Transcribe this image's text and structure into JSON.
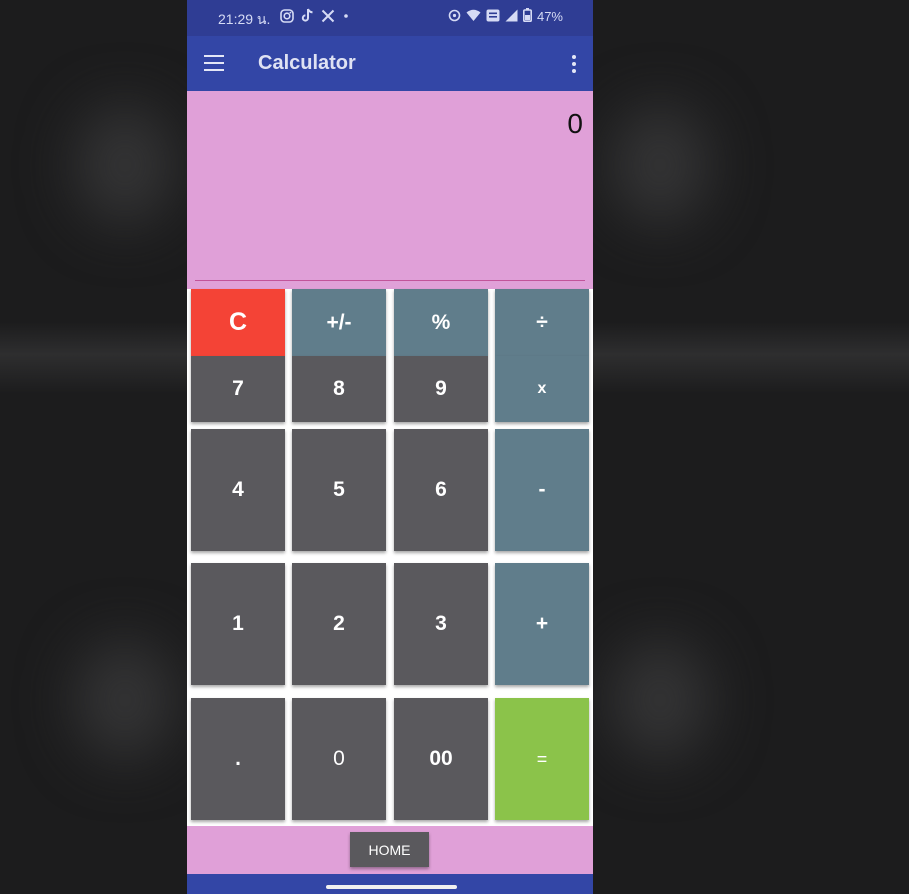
{
  "status_bar": {
    "time": "21:29 น.",
    "left_icons": [
      "instagram-icon",
      "tiktok-icon",
      "x-icon",
      "dot-icon"
    ],
    "battery": "47%",
    "right_icons": [
      "sync-icon",
      "wifi-icon",
      "volte-icon",
      "signal-icon",
      "battery-icon"
    ]
  },
  "app_bar": {
    "title": "Calculator",
    "menu_icon": "hamburger-menu-icon",
    "overflow_icon": "more-vert-icon"
  },
  "display": {
    "value": "0"
  },
  "keypad": {
    "rows": [
      [
        "C",
        "+/-",
        "%",
        "÷"
      ],
      [
        "7",
        "8",
        "9",
        "x"
      ],
      [
        "4",
        "5",
        "6",
        "-"
      ],
      [
        "1",
        "2",
        "3",
        "+"
      ],
      [
        ".",
        "0",
        "00",
        "="
      ]
    ]
  },
  "footer": {
    "home_label": "HOME"
  },
  "colors": {
    "status_bar": "#2f3d94",
    "app_bar": "#3346a6",
    "display_bg": "#e0a0d8",
    "number_key": "#5a595d",
    "operator_key": "#607d8b",
    "clear_key": "#f44336",
    "equals_key": "#8bc34a"
  }
}
